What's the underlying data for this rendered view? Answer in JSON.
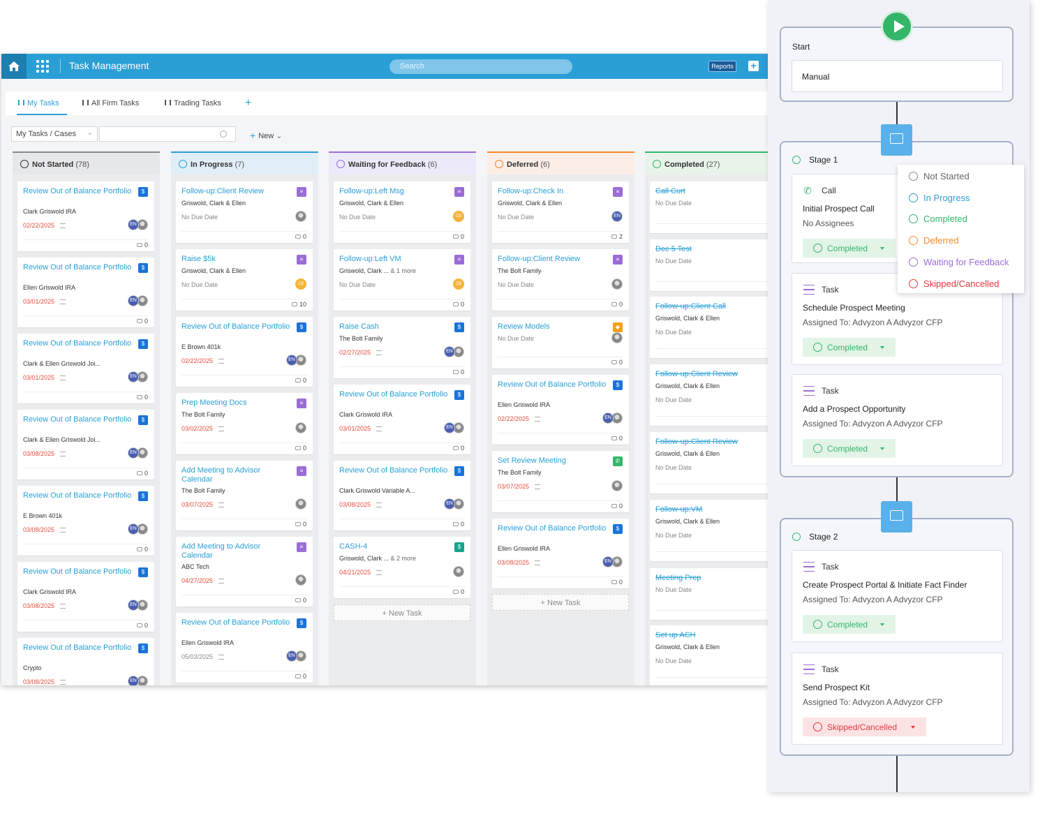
{
  "topbar": {
    "title": "Task Management",
    "search_placeholder": "Search",
    "reports_label": "Reports"
  },
  "tabs": [
    {
      "label": "My Tasks"
    },
    {
      "label": "All Firm Tasks"
    },
    {
      "label": "Trading Tasks"
    }
  ],
  "filter": {
    "cases_label": "My Tasks / Cases",
    "new_label": "New"
  },
  "colors": {
    "primary": "#2a9fd6",
    "not_started": "#888888",
    "in_progress": "#2a9fd6",
    "waiting": "#9b6cd6",
    "deferred": "#f08a2a",
    "completed": "#34b567",
    "skipped": "#e5373f"
  },
  "columns": [
    {
      "name": "Not Started",
      "count": "(78)"
    },
    {
      "name": "In Progress",
      "count": "(7)"
    },
    {
      "name": "Waiting for Feedback",
      "count": "(6)"
    },
    {
      "name": "Deferred",
      "count": "(6)"
    },
    {
      "name": "Completed",
      "count": "(27)"
    }
  ],
  "cards": {
    "c0": [
      {
        "title": "Review Out of Balance Portfolio",
        "sub": "Clark Griswold IRA",
        "date": "02/22/2025",
        "comments": "0"
      },
      {
        "title": "Review Out of Balance Portfolio",
        "sub": "Ellen Griswold IRA",
        "date": "03/01/2025",
        "comments": "0"
      },
      {
        "title": "Review Out of Balance Portfolio",
        "sub": "Clark & Ellen Griswold Joi...",
        "date": "03/01/2025",
        "comments": "0"
      },
      {
        "title": "Review Out of Balance Portfolio",
        "sub": "Clark & Ellen Griswold Joi...",
        "date": "03/08/2025",
        "comments": "0"
      },
      {
        "title": "Review Out of Balance Portfolio",
        "sub": "E Brown 401k",
        "date": "03/08/2025",
        "comments": "0"
      },
      {
        "title": "Review Out of Balance Portfolio",
        "sub": "Clark Griswold IRA",
        "date": "03/08/2025",
        "comments": "0"
      },
      {
        "title": "Review Out of Balance Portfolio",
        "sub": "Crypto",
        "date": "03/08/2025",
        "comments": "0"
      }
    ],
    "c1": [
      {
        "title": "Follow-up:Client Review",
        "sub": "Griswold, Clark & Ellen",
        "date": "No Due Date",
        "comments": "0"
      },
      {
        "title": "Raise $5k",
        "sub": "Griswold, Clark & Ellen",
        "date": "No Due Date",
        "comments": "10",
        "initials": "CB"
      },
      {
        "title": "Review Out of Balance Portfolio",
        "sub": "E Brown 401k",
        "date": "02/22/2025",
        "comments": "0"
      },
      {
        "title": "Prep Meeting Docs",
        "sub": "The Bolt Family",
        "date": "03/02/2025",
        "comments": "0"
      },
      {
        "title": "Add Meeting to Advisor Calendar",
        "sub": "The Bolt Family",
        "date": "03/07/2025",
        "comments": "0"
      },
      {
        "title": "Add Meeting to Advisor Calendar",
        "sub": "ABC Tech",
        "date": "04/27/2025",
        "comments": "0"
      },
      {
        "title": "Review Out of Balance Portfolio",
        "sub": "Ellen Griswold IRA",
        "date": "05/03/2025",
        "comments": "0"
      }
    ],
    "c2": [
      {
        "title": "Follow-up:Left Msg",
        "sub": "Griswold, Clark & Ellen",
        "date": "No Due Date",
        "comments": "0",
        "initials": "CB"
      },
      {
        "title": "Follow-up:Left VM",
        "sub": "Griswold, Clark ...",
        "more": "& 1 more",
        "date": "No Due Date",
        "comments": "0",
        "initials": "CB"
      },
      {
        "title": "Raise Cash",
        "sub": "The Bolt Family",
        "date": "02/27/2025",
        "comments": "0"
      },
      {
        "title": "Review Out of Balance Portfolio",
        "sub": "Clark Griswold IRA",
        "date": "03/01/2025",
        "comments": "0"
      },
      {
        "title": "Review Out of Balance Portfolio",
        "sub": "Clark Griswold Variable A...",
        "date": "03/08/2025",
        "comments": "0"
      },
      {
        "title": "CASH-4",
        "sub": "Griswold, Clark ...",
        "more": "& 2 more",
        "date": "04/21/2025",
        "comments": "0"
      }
    ],
    "c3": [
      {
        "title": "Follow-up:Check In",
        "sub": "Griswold, Clark & Ellen",
        "date": "No Due Date",
        "comments": "2"
      },
      {
        "title": "Follow-up:Client Review",
        "sub": "The Bolt Family",
        "date": "No Due Date",
        "comments": "0"
      },
      {
        "title": "Review Models",
        "sub": "",
        "date": "No Due Date",
        "comments": "0"
      },
      {
        "title": "Review Out of Balance Portfolio",
        "sub": "Ellen Griswold IRA",
        "date": "02/22/2025",
        "comments": "0"
      },
      {
        "title": "Set Review Meeting",
        "sub": "The Bolt Family",
        "date": "03/07/2025",
        "comments": "0"
      },
      {
        "title": "Review Out of Balance Portfolio",
        "sub": "Ellen Griswold IRA",
        "date": "03/08/2025",
        "comments": "0"
      }
    ],
    "c4": [
      {
        "title": "Call Curt",
        "sub": "",
        "date": "No Due Date"
      },
      {
        "title": "Dec 5 Test",
        "sub": "",
        "date": "No Due Date"
      },
      {
        "title": "Follow-up:Client Call",
        "sub": "Griswold, Clark & Ellen",
        "date": "No Due Date"
      },
      {
        "title": "Follow-up:Client Review",
        "sub": "Griswold, Clark & Ellen",
        "date": "No Due Date"
      },
      {
        "title": "Follow-up:Client Review",
        "sub": "Griswold, Clark & Ellen",
        "date": "No Due Date"
      },
      {
        "title": "Follow-up:VM",
        "sub": "Griswold, Clark & Ellen",
        "date": "No Due Date"
      },
      {
        "title": "Meeting Prep",
        "sub": "",
        "date": "No Due Date"
      },
      {
        "title": "Set up ACH",
        "sub": "Griswold, Clark & Ellen",
        "date": "No Due Date"
      }
    ]
  },
  "new_task_label": "New Task",
  "workflow": {
    "start_label": "Start",
    "trigger": "Manual",
    "stage1": {
      "label": "Stage 1",
      "tasks": [
        {
          "kind": "Call",
          "name": "Initial Prospect Call",
          "assigned": "No Assignees",
          "status": "Completed"
        },
        {
          "kind": "Task",
          "name": "Schedule Prospect Meeting",
          "assigned": "Assigned To: Advyzon A Advyzor CFP",
          "status": "Completed"
        },
        {
          "kind": "Task",
          "name": "Add a Prospect Opportunity",
          "assigned": "Assigned To: Advyzon A Advyzor CFP",
          "status": "Completed"
        }
      ]
    },
    "stage2": {
      "label": "Stage 2",
      "tasks": [
        {
          "kind": "Task",
          "name": "Create Prospect Portal & Initiate Fact Finder",
          "assigned": "Assigned To: Advyzon A Advyzor CFP",
          "status": "Completed"
        },
        {
          "kind": "Task",
          "name": "Send Prospect Kit",
          "assigned": "Assigned To: Advyzon A Advyzor CFP",
          "status": "Skipped/Cancelled"
        }
      ]
    },
    "status_menu": [
      "Not Started",
      "In Progress",
      "Completed",
      "Deferred",
      "Waiting for Feedback",
      "Skipped/Cancelled"
    ]
  }
}
